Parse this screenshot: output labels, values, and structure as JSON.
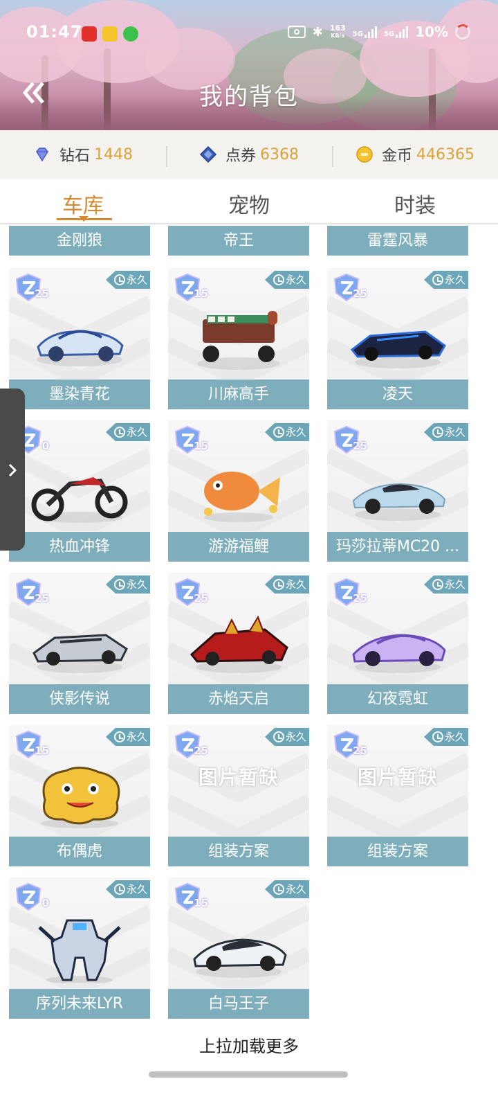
{
  "status_bar": {
    "time": "01:47",
    "net_speed_top": "163",
    "net_speed_bottom": "KB/s",
    "signal1": "5G",
    "signal2": "5G",
    "battery": "10%"
  },
  "header": {
    "title": "我的背包",
    "back_icon": "double-chevron-left-icon"
  },
  "currency": [
    {
      "label": "钻石",
      "value": "1448",
      "icon": "diamond-icon",
      "color": "#5b6fd6"
    },
    {
      "label": "点券",
      "value": "6368",
      "icon": "coupon-icon",
      "color": "#3d5fb8"
    },
    {
      "label": "金币",
      "value": "446365",
      "icon": "coin-icon",
      "color": "#f2c230"
    }
  ],
  "tabs": [
    {
      "label": "车库",
      "active": true
    },
    {
      "label": "宠物",
      "active": false
    },
    {
      "label": "时装",
      "active": false
    }
  ],
  "partial_row": [
    "金刚狼",
    "帝王",
    "雷霆风暴"
  ],
  "permanent_label": "永久",
  "placeholder_text": "图片暂缺",
  "items": [
    {
      "name": "墨染青花",
      "level": "25",
      "art": "car-blue-white"
    },
    {
      "name": "川麻高手",
      "level": "15",
      "art": "mahjong-kart"
    },
    {
      "name": "凌天",
      "level": "25",
      "art": "car-dark-blue"
    },
    {
      "name": "热血冲锋",
      "level": "0",
      "art": "motorcycle"
    },
    {
      "name": "游游福鲤",
      "level": "15",
      "art": "goldfish"
    },
    {
      "name": "玛莎拉蒂MC20 ...",
      "level": "25",
      "art": "car-light-blue"
    },
    {
      "name": "侠影传说",
      "level": "25",
      "art": "car-silver"
    },
    {
      "name": "赤焰天启",
      "level": "25",
      "art": "car-red"
    },
    {
      "name": "幻夜霓虹",
      "level": "25",
      "art": "car-purple"
    },
    {
      "name": "布偶虎",
      "level": "15",
      "art": "tiger-plush"
    },
    {
      "name": "组装方案",
      "level": "25",
      "art": "placeholder"
    },
    {
      "name": "组装方案",
      "level": "25",
      "art": "placeholder"
    },
    {
      "name": "序列未来LYR",
      "level": "0",
      "art": "robot"
    },
    {
      "name": "白马王子",
      "level": "15",
      "art": "car-white"
    }
  ],
  "side_handle_icon": "chevron-right-icon",
  "load_more": "上拉加载更多"
}
